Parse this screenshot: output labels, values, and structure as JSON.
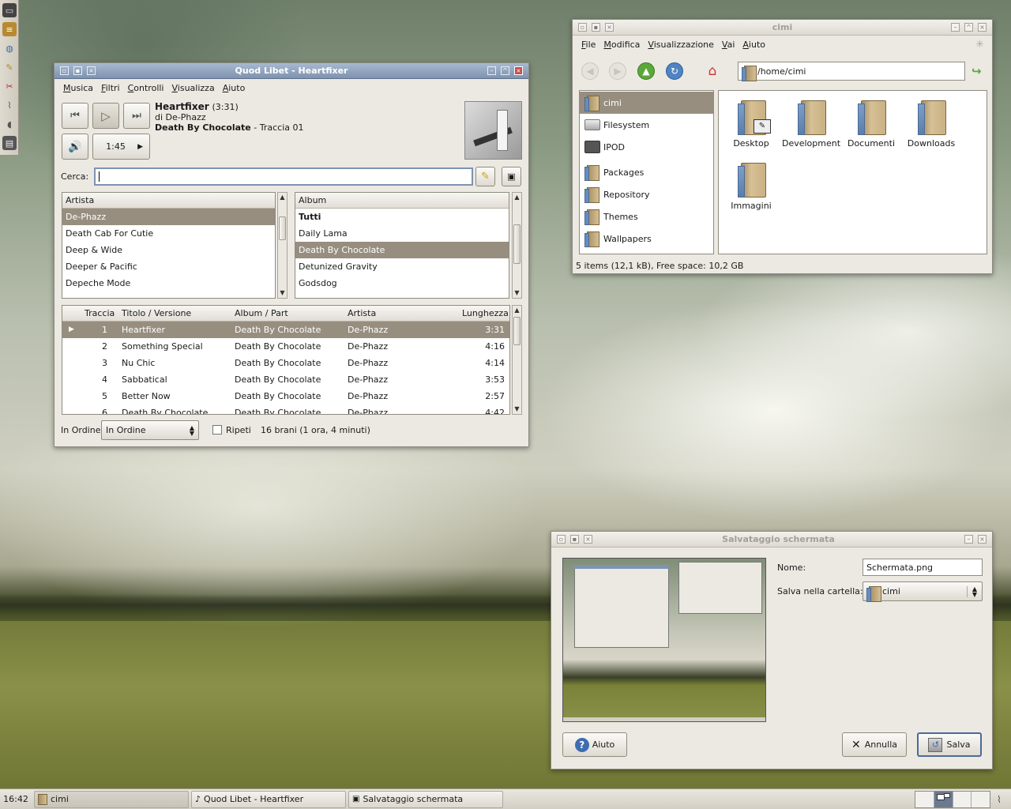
{
  "dock": {
    "icons": [
      "terminal-icon",
      "notes-icon",
      "globe-icon",
      "editor-icon",
      "scissors-icon",
      "brush-icon",
      "volume-icon",
      "film-icon"
    ]
  },
  "quodlibet": {
    "title": "Quod Libet - Heartfixer",
    "menu": [
      "Musica",
      "Filtri",
      "Controlli",
      "Visualizza",
      "Aiuto"
    ],
    "song_title": "Heartfixer",
    "song_duration": "(3:31)",
    "song_artist": "di De-Phazz",
    "song_album": "Death By Chocolate",
    "song_track": " - Traccia 01",
    "position": "1:45",
    "search_label": "Cerca:",
    "search_value": "",
    "artist_header": "Artista",
    "artists": [
      "De-Phazz",
      "Death Cab For Cutie",
      "Deep & Wide",
      "Deeper & Pacific",
      "Depeche Mode"
    ],
    "album_header": "Album",
    "albums": [
      "Tutti",
      "Daily Lama",
      "Death By Chocolate",
      "Detunized Gravity",
      "Godsdog"
    ],
    "columns": {
      "track": "Traccia",
      "title": "Titolo / Versione",
      "album": "Album / Part",
      "artist": "Artista",
      "length": "Lunghezza"
    },
    "tracks": [
      {
        "n": "1",
        "title": "Heartfixer",
        "album": "Death By Chocolate",
        "artist": "De-Phazz",
        "len": "3:31"
      },
      {
        "n": "2",
        "title": "Something Special",
        "album": "Death By Chocolate",
        "artist": "De-Phazz",
        "len": "4:16"
      },
      {
        "n": "3",
        "title": "Nu Chic",
        "album": "Death By Chocolate",
        "artist": "De-Phazz",
        "len": "4:14"
      },
      {
        "n": "4",
        "title": "Sabbatical",
        "album": "Death By Chocolate",
        "artist": "De-Phazz",
        "len": "3:53"
      },
      {
        "n": "5",
        "title": "Better Now",
        "album": "Death By Chocolate",
        "artist": "De-Phazz",
        "len": "2:57"
      },
      {
        "n": "6",
        "title": "Death By Chocolate",
        "album": "Death By Chocolate",
        "artist": "De-Phazz",
        "len": "4:42"
      }
    ],
    "order_label": "In Ordine",
    "order_value": "In Ordine",
    "repeat_label": "Ripeti",
    "status": "16 brani (1 ora, 4 minuti)"
  },
  "filemanager": {
    "title": "cimi",
    "menu": [
      "File",
      "Modifica",
      "Visualizzazione",
      "Vai",
      "Aiuto"
    ],
    "path": "/home/cimi",
    "places": [
      "cimi",
      "Filesystem",
      "IPOD"
    ],
    "bookmarks": [
      "Packages",
      "Repository",
      "Themes",
      "Wallpapers"
    ],
    "items": [
      "Desktop",
      "Development",
      "Documenti",
      "Downloads",
      "Immagini"
    ],
    "status": "5 items (12,1 kB), Free space: 10,2 GB"
  },
  "screenshot_dialog": {
    "title": "Salvataggio schermata",
    "name_label": "Nome:",
    "name_value": "Schermata.png",
    "folder_label": "Salva nella cartella:",
    "folder_value": "cimi",
    "help_button": "Aiuto",
    "cancel_button": "Annulla",
    "save_button": "Salva"
  },
  "taskbar": {
    "clock": "16:42",
    "tasks": [
      "cimi",
      "Quod Libet - Heartfixer",
      "Salvataggio schermata"
    ]
  },
  "colors": {
    "selection": "#978e80",
    "active_title": "#7e93b1"
  }
}
